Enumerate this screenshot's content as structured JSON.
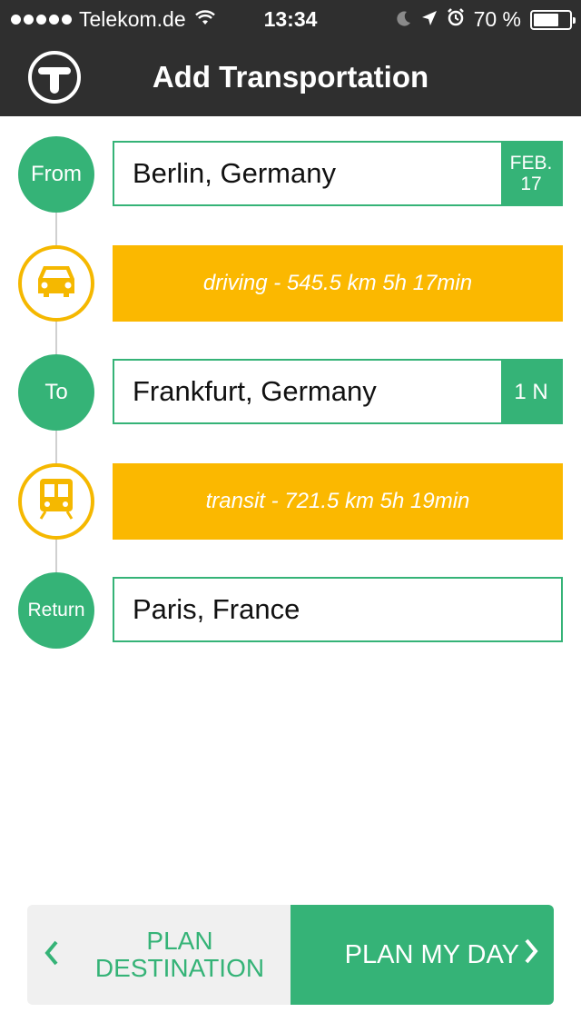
{
  "status": {
    "carrier": "Telekom.de",
    "time": "13:34",
    "battery": "70 %",
    "battery_level": 0.7
  },
  "header": {
    "title": "Add Transportation"
  },
  "stops": [
    {
      "badge": "From",
      "place": "Berlin, Germany",
      "date_line1": "FEB.",
      "date_line2": "17"
    },
    {
      "badge": "To",
      "place": "Frankfurt, Germany",
      "nights": "1 N"
    },
    {
      "badge": "Return",
      "place": "Paris, France"
    }
  ],
  "legs": [
    {
      "mode_icon": "car-icon",
      "text": "driving - 545.5 km 5h 17min"
    },
    {
      "mode_icon": "train-icon",
      "text": "transit - 721.5 km 5h 19min"
    }
  ],
  "footer": {
    "prev_label_line1": "PLAN",
    "prev_label_line2": "DESTINATION",
    "next_label": "PLAN MY DAY"
  },
  "colors": {
    "green": "#35b377",
    "orange": "#fbb800",
    "dark": "#2f2f2f"
  }
}
